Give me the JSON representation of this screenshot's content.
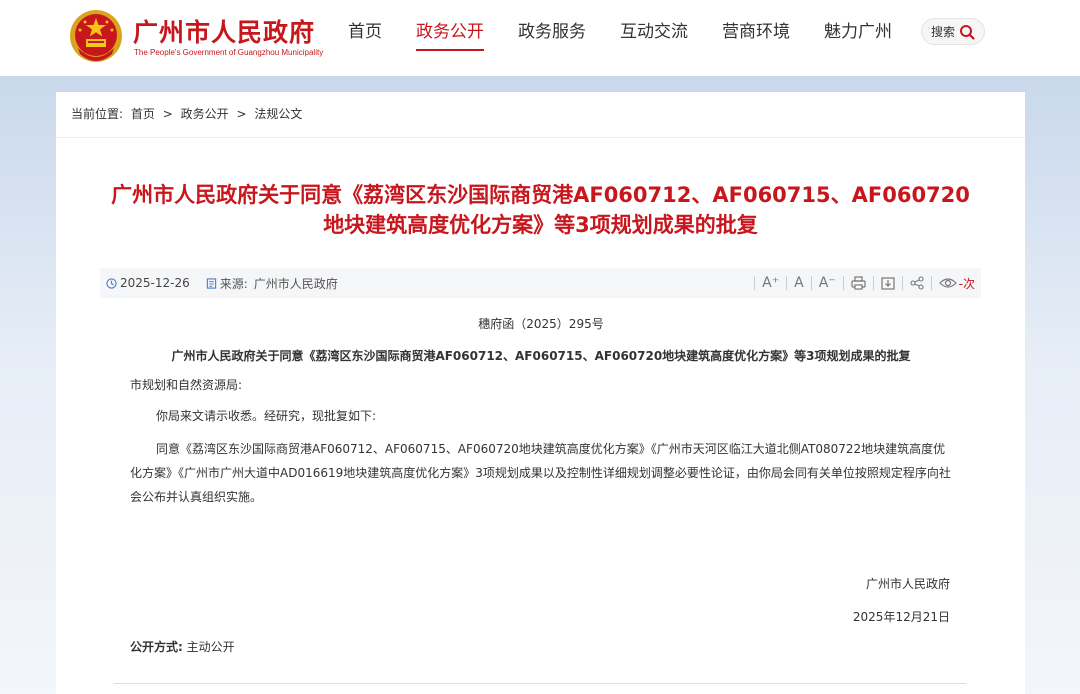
{
  "header": {
    "site_title": "广州市人民政府",
    "site_subtitle": "The People's Government of Guangzhou Municipality",
    "nav": [
      "首页",
      "政务公开",
      "政务服务",
      "互动交流",
      "营商环境",
      "魅力广州"
    ],
    "active_nav": "政务公开",
    "search_label": "搜索"
  },
  "breadcrumb": {
    "prefix": "当前位置:",
    "items": [
      "首页",
      "政务公开",
      "法规公文"
    ],
    "separator": ">"
  },
  "article": {
    "title_line1": "广州市人民政府关于同意《荔湾区东沙国际商贸港AF060712、AF060715、AF060720",
    "title_line2": "地块建筑高度优化方案》等3项规划成果的批复",
    "date": "2025-12-26",
    "source_label": "来源:",
    "source": "广州市人民政府",
    "tools": [
      "A⁺",
      "A",
      "A⁻"
    ],
    "views_suffix": "-次",
    "doc_number": "穗府函（2025）295号",
    "doc_subtitle": "广州市人民政府关于同意《荔湾区东沙国际商贸港AF060712、AF060715、AF060720地块建筑高度优化方案》等3项规划成果的批复",
    "addressee": "市规划和自然资源局:",
    "para1": "你局来文请示收悉。经研究，现批复如下:",
    "para2": "同意《荔湾区东沙国际商贸港AF060712、AF060715、AF060720地块建筑高度优化方案》《广州市天河区临江大道北侧AT080722地块建筑高度优化方案》《广州市广州大道中AD016619地块建筑高度优化方案》3项规划成果以及控制性详细规划调整必要性论证，由你局会同有关单位按照规定程序向社会公布并认真组织实施。",
    "signer": "广州市人民政府",
    "sign_date": "2025年12月21日",
    "disclosure_label": "公开方式:",
    "disclosure_value": "主动公开"
  },
  "colors": {
    "brand_red": "#c8161d",
    "band_blue": "#c9d8ec"
  }
}
